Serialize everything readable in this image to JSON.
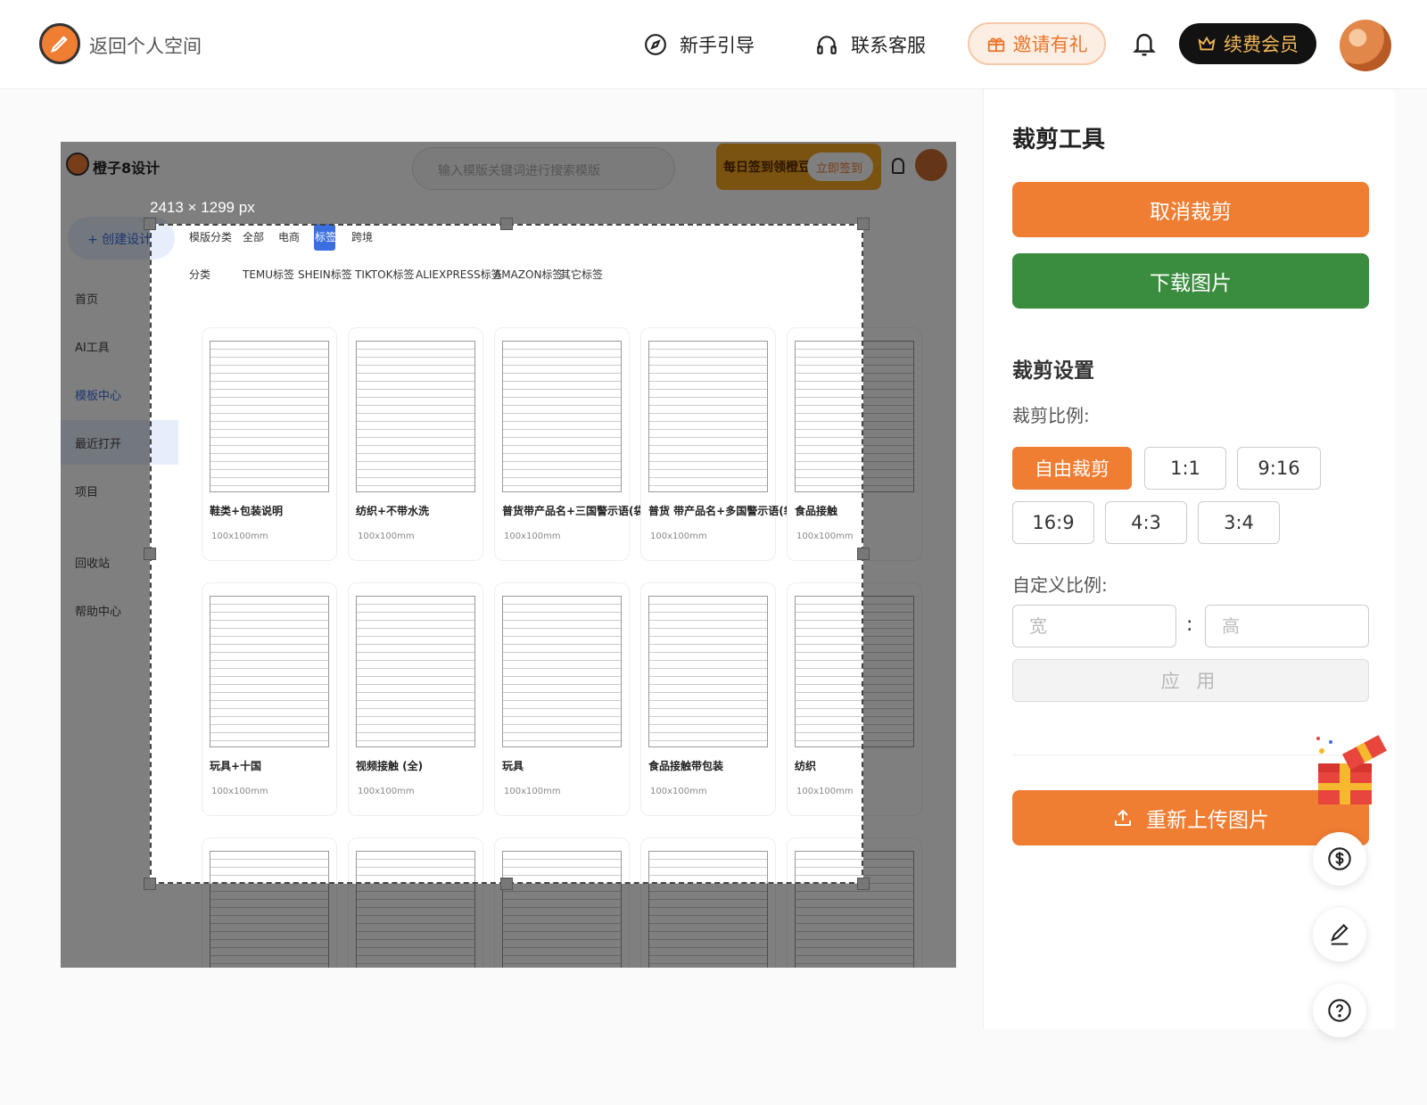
{
  "header": {
    "back_label": "返回个人空间",
    "guide_label": "新手引导",
    "support_label": "联系客服",
    "invite_label": "邀请有礼",
    "renew_label": "续费会员"
  },
  "preview": {
    "size_label": "2413 × 1299 px",
    "screenshot": {
      "brand": "橙子8设计",
      "search_placeholder": "输入模版关键词进行搜索模版",
      "signin_text": "每日签到领橙豆",
      "signin_button": "立即签到",
      "create_button": "+ 创建设计",
      "sidebar": [
        "首页",
        "AI工具",
        "模板中心",
        "最近打开",
        "项目",
        "回收站",
        "帮助中心"
      ],
      "row1_tabs": [
        "模版分类",
        "全部",
        "电商",
        "标签",
        "跨境"
      ],
      "row2_tabs": [
        "分类",
        "TEMU标签",
        "SHEIN标签",
        "TIKTOK标签",
        "ALIEXPRESS标签",
        "AMAZON标签",
        "其它标签"
      ],
      "cards": [
        {
          "title": "鞋类+包装说明",
          "size": "100x100mm"
        },
        {
          "title": "纺织+不带水洗",
          "size": "100x100mm"
        },
        {
          "title": "普货带产品名+三国警示语(袋装)",
          "size": "100x100mm"
        },
        {
          "title": "普货 带产品名+多国警示语(袋装)",
          "size": "100x100mm"
        },
        {
          "title": "食品接触",
          "size": "100x100mm"
        },
        {
          "title": "玩具+十国",
          "size": "100x100mm"
        },
        {
          "title": "视频接触 (全)",
          "size": "100x100mm"
        },
        {
          "title": "玩具",
          "size": "100x100mm"
        },
        {
          "title": "食品接触带包装",
          "size": "100x100mm"
        },
        {
          "title": "纺织",
          "size": "100x100mm"
        }
      ]
    }
  },
  "panel": {
    "title": "裁剪工具",
    "cancel_label": "取消裁剪",
    "download_label": "下载图片",
    "settings_title": "裁剪设置",
    "ratio_label": "裁剪比例:",
    "ratios": [
      "自由裁剪",
      "1:1",
      "9:16",
      "16:9",
      "4:3",
      "3:4"
    ],
    "active_ratio": "自由裁剪",
    "custom_label": "自定义比例:",
    "width_placeholder": "宽",
    "height_placeholder": "高",
    "colon": ":",
    "apply_label": "应 用",
    "reupload_label": "重新上传图片"
  },
  "colors": {
    "accent": "#ef7d32",
    "download": "#3a8c3e",
    "renew_bg": "#121212",
    "renew_text": "#f3b857"
  },
  "icons": [
    "compass-icon",
    "headphones-icon",
    "gift-icon",
    "bell-icon",
    "crown-icon",
    "upload-icon",
    "dollar-icon",
    "pen-icon",
    "help-icon"
  ]
}
